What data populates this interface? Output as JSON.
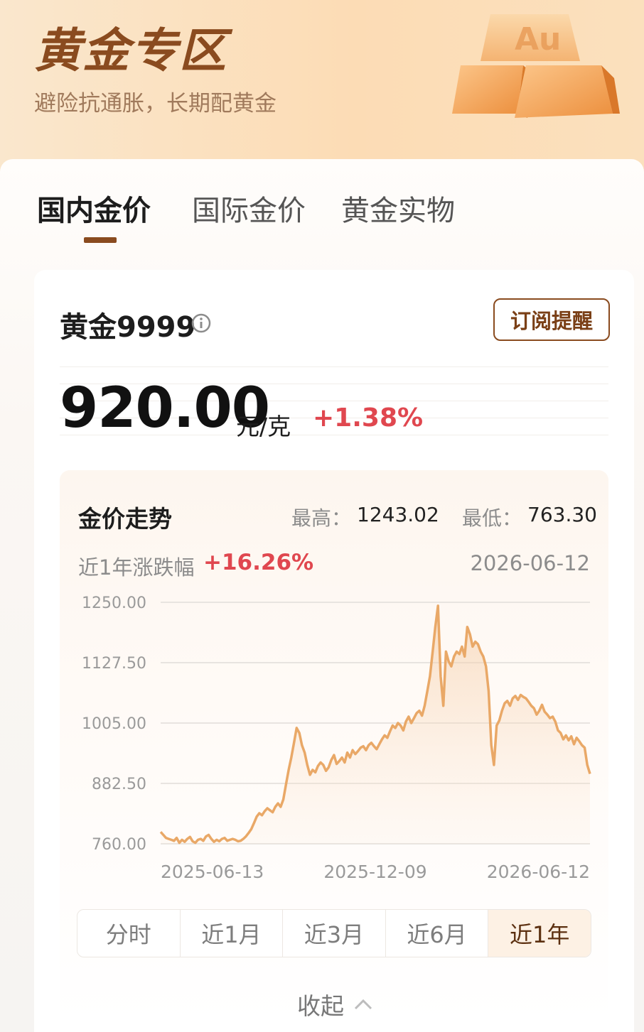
{
  "header": {
    "title": "黄金专区",
    "subtitle": "避险抗通胀，长期配黄金",
    "gold_bar_text": "Au"
  },
  "tabs": [
    {
      "label": "国内金价",
      "active": true
    },
    {
      "label": "国际金价",
      "active": false
    },
    {
      "label": "黄金实物",
      "active": false
    }
  ],
  "product": {
    "name": "黄金9999",
    "subscribe_label": "订阅提醒",
    "price": "920.00",
    "unit": "元/克",
    "change": "+1.38%"
  },
  "trend": {
    "title": "金价走势",
    "high_label": "最高：",
    "high_value": "1243.02",
    "low_label": "最低：",
    "low_value": "763.30",
    "range_label": "近1年涨跌幅",
    "range_change": "+16.26%",
    "as_of_date": "2026-06-12"
  },
  "periods": [
    {
      "label": "分时",
      "active": false
    },
    {
      "label": "近1月",
      "active": false
    },
    {
      "label": "近3月",
      "active": false
    },
    {
      "label": "近6月",
      "active": false
    },
    {
      "label": "近1年",
      "active": true
    }
  ],
  "collapse_label": "收起",
  "colors": {
    "brand": "#8a4b1f",
    "up": "#e0474f",
    "line": "#e9a867"
  },
  "chart_data": {
    "type": "area",
    "ylim": [
      760,
      1250
    ],
    "yticks": [
      "1250.00",
      "1127.50",
      "1005.00",
      "882.50",
      "760.00"
    ],
    "xticks": [
      "2025-06-13",
      "2025-12-09",
      "2026-06-12"
    ],
    "xlabel": "",
    "ylabel": "",
    "grid": true,
    "series": [
      {
        "values": [
          784,
          778,
          772,
          770,
          768,
          766,
          772,
          762,
          768,
          764,
          770,
          774,
          765,
          762,
          768,
          770,
          766,
          775,
          778,
          770,
          764,
          768,
          765,
          770,
          772,
          766,
          768,
          770,
          768,
          765,
          766,
          770,
          775,
          782,
          790,
          802,
          815,
          822,
          818,
          826,
          832,
          828,
          824,
          835,
          842,
          835,
          850,
          880,
          910,
          935,
          965,
          995,
          985,
          960,
          945,
          920,
          900,
          910,
          905,
          918,
          925,
          920,
          908,
          915,
          930,
          940,
          922,
          928,
          935,
          925,
          945,
          935,
          950,
          942,
          948,
          955,
          958,
          950,
          960,
          965,
          958,
          952,
          962,
          972,
          980,
          975,
          988,
          1000,
          995,
          1005,
          1000,
          990,
          1008,
          1018,
          1005,
          1015,
          1025,
          1030,
          1020,
          1040,
          1070,
          1100,
          1150,
          1200,
          1243,
          1100,
          1040,
          1150,
          1130,
          1120,
          1140,
          1150,
          1145,
          1160,
          1140,
          1200,
          1185,
          1160,
          1170,
          1165,
          1150,
          1140,
          1120,
          1070,
          960,
          920,
          1000,
          1010,
          1030,
          1045,
          1050,
          1040,
          1055,
          1060,
          1052,
          1062,
          1058,
          1055,
          1048,
          1040,
          1035,
          1022,
          1030,
          1042,
          1028,
          1022,
          1015,
          1018,
          1008,
          990,
          985,
          972,
          980,
          970,
          978,
          962,
          975,
          968,
          960,
          955,
          920,
          902
        ]
      }
    ]
  }
}
